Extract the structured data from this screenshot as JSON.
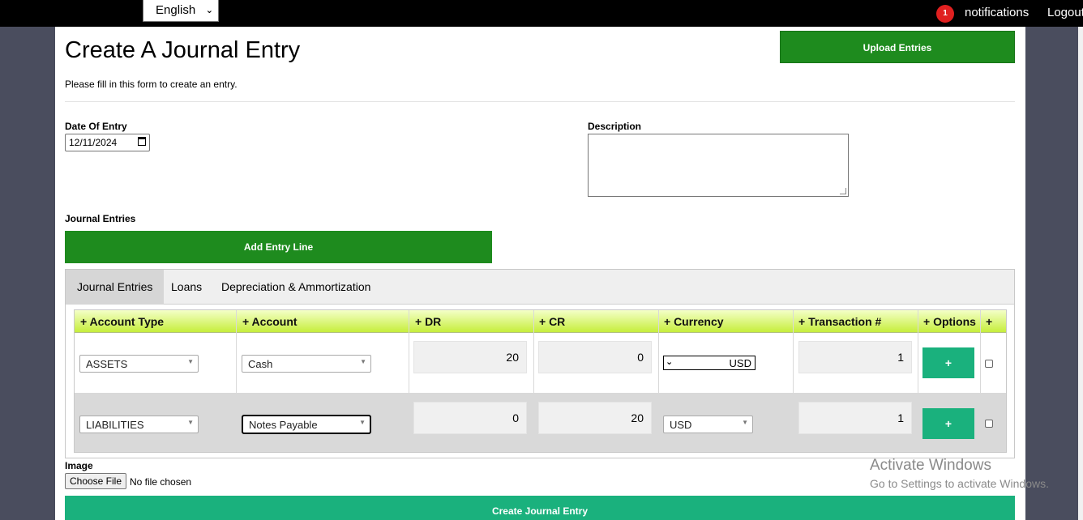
{
  "topbar": {
    "language": "English",
    "notification_count": "1",
    "notifications_label": "notifications",
    "logout_label": "Logout"
  },
  "header": {
    "title": "Create A Journal Entry",
    "subtitle": "Please fill in this form to create an entry.",
    "upload_label": "Upload Entries"
  },
  "form": {
    "date_label": "Date Of Entry",
    "date_value": "12/11/2024",
    "description_label": "Description",
    "description_value": "",
    "journal_entries_label": "Journal Entries",
    "add_line_label": "Add Entry Line"
  },
  "tabs": [
    "Journal Entries",
    "Loans",
    "Depreciation & Ammortization"
  ],
  "grid": {
    "headers": [
      "+ Account Type",
      "+ Account",
      "+ DR",
      "+ CR",
      "+ Currency",
      "+ Transaction #",
      "+ Options",
      "+"
    ],
    "rows": [
      {
        "account_type": "ASSETS",
        "account": "Cash",
        "dr": "20",
        "cr": "0",
        "currency": "USD",
        "transaction": "1",
        "option": "+"
      },
      {
        "account_type": "LIABILITIES",
        "account": "Notes Payable",
        "dr": "0",
        "cr": "20",
        "currency": "USD",
        "transaction": "1",
        "option": "+"
      }
    ]
  },
  "image": {
    "label": "Image",
    "choose_label": "Choose File",
    "status": "No file chosen"
  },
  "submit_label": "Create Journal Entry",
  "watermark": {
    "line1": "Activate Windows",
    "line2": "Go to Settings to activate Windows."
  },
  "colors": {
    "topbar": "#000000",
    "primary_green": "#1e8b1e",
    "teal_button": "#1ab17d",
    "header_gradient_start": "#f4ffc8",
    "header_gradient_end": "#c6ee3c",
    "badge": "#e02020"
  }
}
